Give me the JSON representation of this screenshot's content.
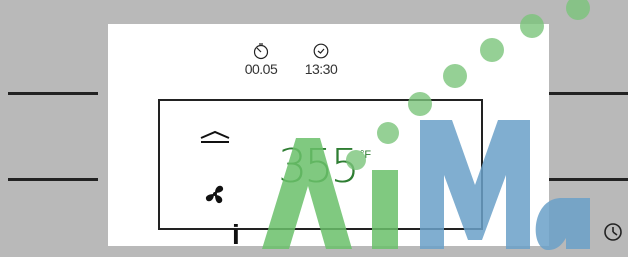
{
  "display": {
    "timer_elapsed": "00.05",
    "clock_time": "13:30",
    "temperature": "355",
    "unit": "°F",
    "info_label": "i"
  },
  "colors": {
    "temperature": "#2e7d32",
    "text": "#222222"
  },
  "icons": {
    "timer": "timer-icon",
    "clock": "clock-icon",
    "heat_mode": "top-heat-icon",
    "fan": "fan-icon",
    "clock_button": "clock-button-icon"
  }
}
